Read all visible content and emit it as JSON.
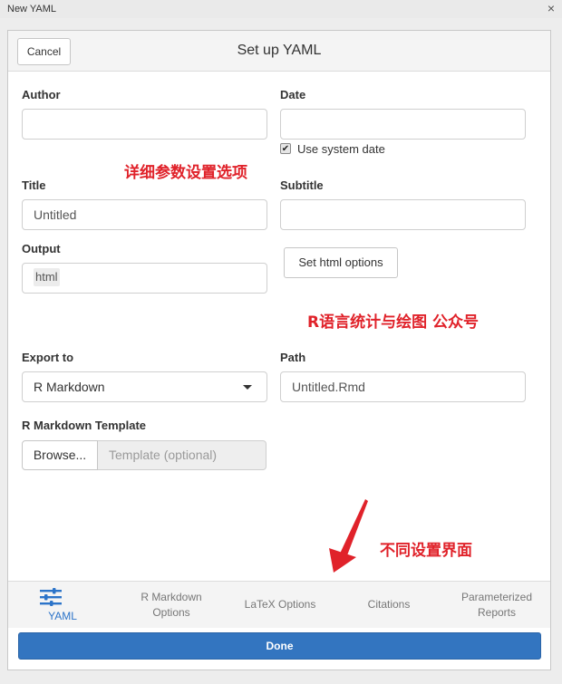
{
  "window": {
    "title": "New YAML",
    "close_glyph": "×"
  },
  "header": {
    "cancel_label": "Cancel",
    "title": "Set up YAML"
  },
  "form": {
    "author": {
      "label": "Author",
      "value": ""
    },
    "date": {
      "label": "Date",
      "value": ""
    },
    "use_system_date": {
      "label": "Use system date",
      "checked": true
    },
    "title": {
      "label": "Title",
      "value": "Untitled"
    },
    "subtitle": {
      "label": "Subtitle",
      "value": ""
    },
    "output": {
      "label": "Output",
      "value": "html"
    },
    "set_html_options_label": "Set html options",
    "export_to": {
      "label": "Export to",
      "value": "R Markdown"
    },
    "path": {
      "label": "Path",
      "value": "Untitled.Rmd"
    },
    "template": {
      "label": "R Markdown Template",
      "browse_label": "Browse...",
      "placeholder": "Template (optional)"
    }
  },
  "annotations": {
    "detail": "详细参数设置选项",
    "wechat": "R语言统计与绘图 公众号",
    "tabs_note": "不同设置界面",
    "color": "#e0222a"
  },
  "tabs": [
    {
      "line1": "YAML",
      "line2": "",
      "icon": "sliders-icon",
      "active": true
    },
    {
      "line1": "R Markdown",
      "line2": "Options",
      "active": false
    },
    {
      "line1": "LaTeX Options",
      "line2": "",
      "active": false
    },
    {
      "line1": "Citations",
      "line2": "",
      "active": false
    },
    {
      "line1": "Parameterized",
      "line2": "Reports",
      "active": false
    }
  ],
  "done_label": "Done",
  "colors": {
    "accent": "#3375c0",
    "active_tab": "#2c74c9"
  }
}
